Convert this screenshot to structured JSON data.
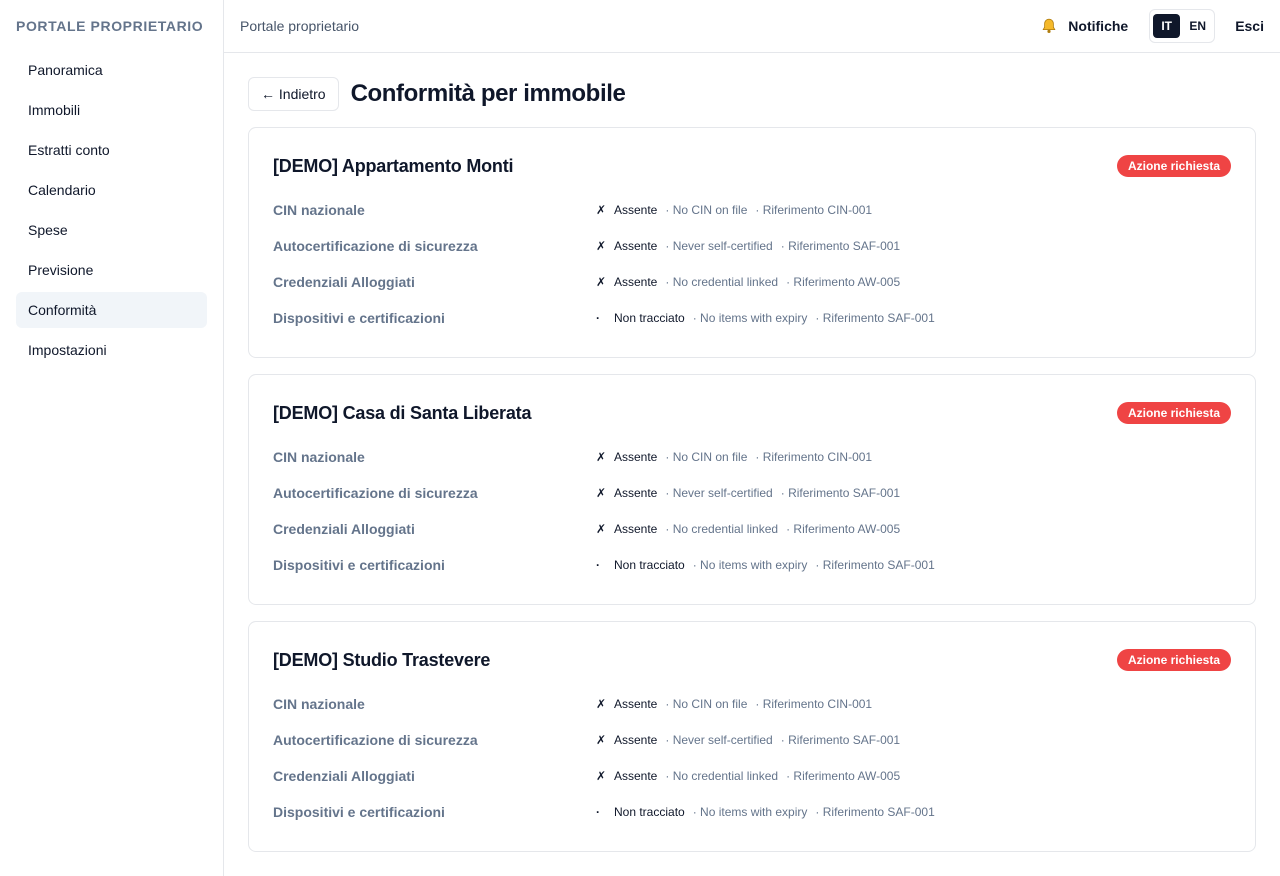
{
  "sidebar": {
    "brand": "PORTALE PROPRIETARIO",
    "items": [
      {
        "label": "Panoramica"
      },
      {
        "label": "Immobili"
      },
      {
        "label": "Estratti conto"
      },
      {
        "label": "Calendario"
      },
      {
        "label": "Spese"
      },
      {
        "label": "Previsione"
      },
      {
        "label": "Conformità",
        "active": true
      },
      {
        "label": "Impostazioni"
      }
    ]
  },
  "topbar": {
    "title": "Portale proprietario",
    "notifications_label": "Notifiche",
    "lang_it": "IT",
    "lang_en": "EN",
    "logout_label": "Esci"
  },
  "page": {
    "back_label": "← Indietro",
    "title": "Conformità per immobile"
  },
  "properties": [
    {
      "name": "[DEMO] Appartamento Monti",
      "badge": "Azione richiesta",
      "rows": [
        {
          "label": "CIN nazionale",
          "icon": "✗",
          "status": "Assente",
          "detail": "· No CIN on file",
          "ref": "· Riferimento CIN-001"
        },
        {
          "label": "Autocertificazione di sicurezza",
          "icon": "✗",
          "status": "Assente",
          "detail": "· Never self-certified",
          "ref": "· Riferimento SAF-001"
        },
        {
          "label": "Credenziali Alloggiati",
          "icon": "✗",
          "status": "Assente",
          "detail": "· No credential linked",
          "ref": "· Riferimento AW-005"
        },
        {
          "label": "Dispositivi e certificazioni",
          "icon": "·",
          "status": "Non tracciato",
          "detail": "· No items with expiry",
          "ref": "· Riferimento SAF-001"
        }
      ]
    },
    {
      "name": "[DEMO] Casa di Santa Liberata",
      "badge": "Azione richiesta",
      "rows": [
        {
          "label": "CIN nazionale",
          "icon": "✗",
          "status": "Assente",
          "detail": "· No CIN on file",
          "ref": "· Riferimento CIN-001"
        },
        {
          "label": "Autocertificazione di sicurezza",
          "icon": "✗",
          "status": "Assente",
          "detail": "· Never self-certified",
          "ref": "· Riferimento SAF-001"
        },
        {
          "label": "Credenziali Alloggiati",
          "icon": "✗",
          "status": "Assente",
          "detail": "· No credential linked",
          "ref": "· Riferimento AW-005"
        },
        {
          "label": "Dispositivi e certificazioni",
          "icon": "·",
          "status": "Non tracciato",
          "detail": "· No items with expiry",
          "ref": "· Riferimento SAF-001"
        }
      ]
    },
    {
      "name": "[DEMO] Studio Trastevere",
      "badge": "Azione richiesta",
      "rows": [
        {
          "label": "CIN nazionale",
          "icon": "✗",
          "status": "Assente",
          "detail": "· No CIN on file",
          "ref": "· Riferimento CIN-001"
        },
        {
          "label": "Autocertificazione di sicurezza",
          "icon": "✗",
          "status": "Assente",
          "detail": "· Never self-certified",
          "ref": "· Riferimento SAF-001"
        },
        {
          "label": "Credenziali Alloggiati",
          "icon": "✗",
          "status": "Assente",
          "detail": "· No credential linked",
          "ref": "· Riferimento AW-005"
        },
        {
          "label": "Dispositivi e certificazioni",
          "icon": "·",
          "status": "Non tracciato",
          "detail": "· No items with expiry",
          "ref": "· Riferimento SAF-001"
        }
      ]
    }
  ],
  "colors": {
    "badge_red": "#ef4444",
    "active_nav_bg": "#f1f5f9",
    "muted_text": "#64748b",
    "primary_text": "#0f172a"
  }
}
